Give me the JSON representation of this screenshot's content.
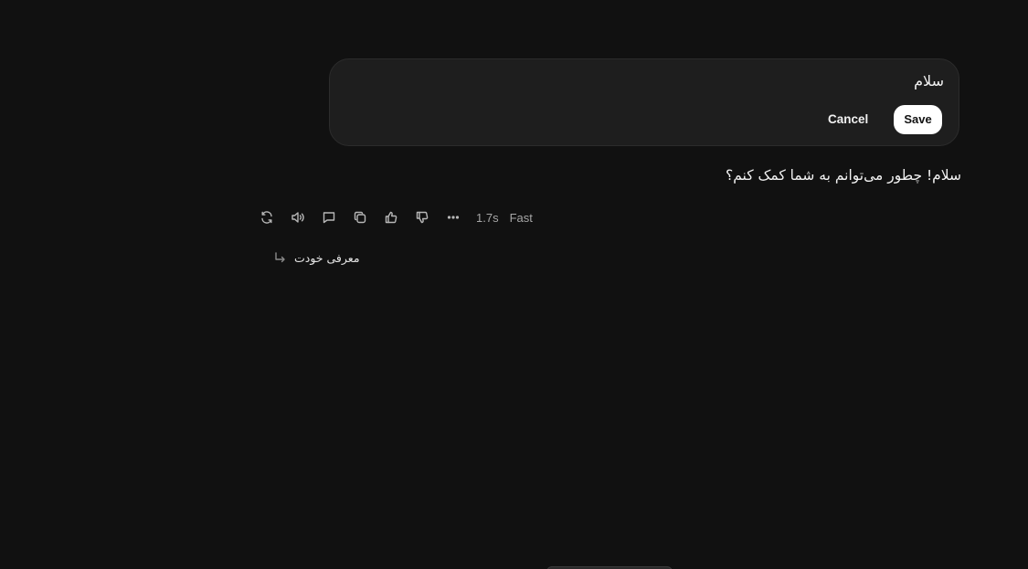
{
  "edit_box": {
    "text": "سلام",
    "cancel_label": "Cancel",
    "save_label": "Save"
  },
  "assistant": {
    "message": "سلام! چطور می‌توانم به شما کمک کنم؟",
    "actions": [
      {
        "icon": "regenerate-icon"
      },
      {
        "icon": "read-aloud-icon"
      },
      {
        "icon": "comment-icon"
      },
      {
        "icon": "copy-icon"
      },
      {
        "icon": "thumbs-up-icon"
      },
      {
        "icon": "thumbs-down-icon"
      },
      {
        "icon": "more-icon"
      }
    ],
    "response_time": "1.7s",
    "mode": "Fast"
  },
  "suggestion": {
    "icon": "reply-arrow-icon",
    "text": "معرفی خودت"
  }
}
